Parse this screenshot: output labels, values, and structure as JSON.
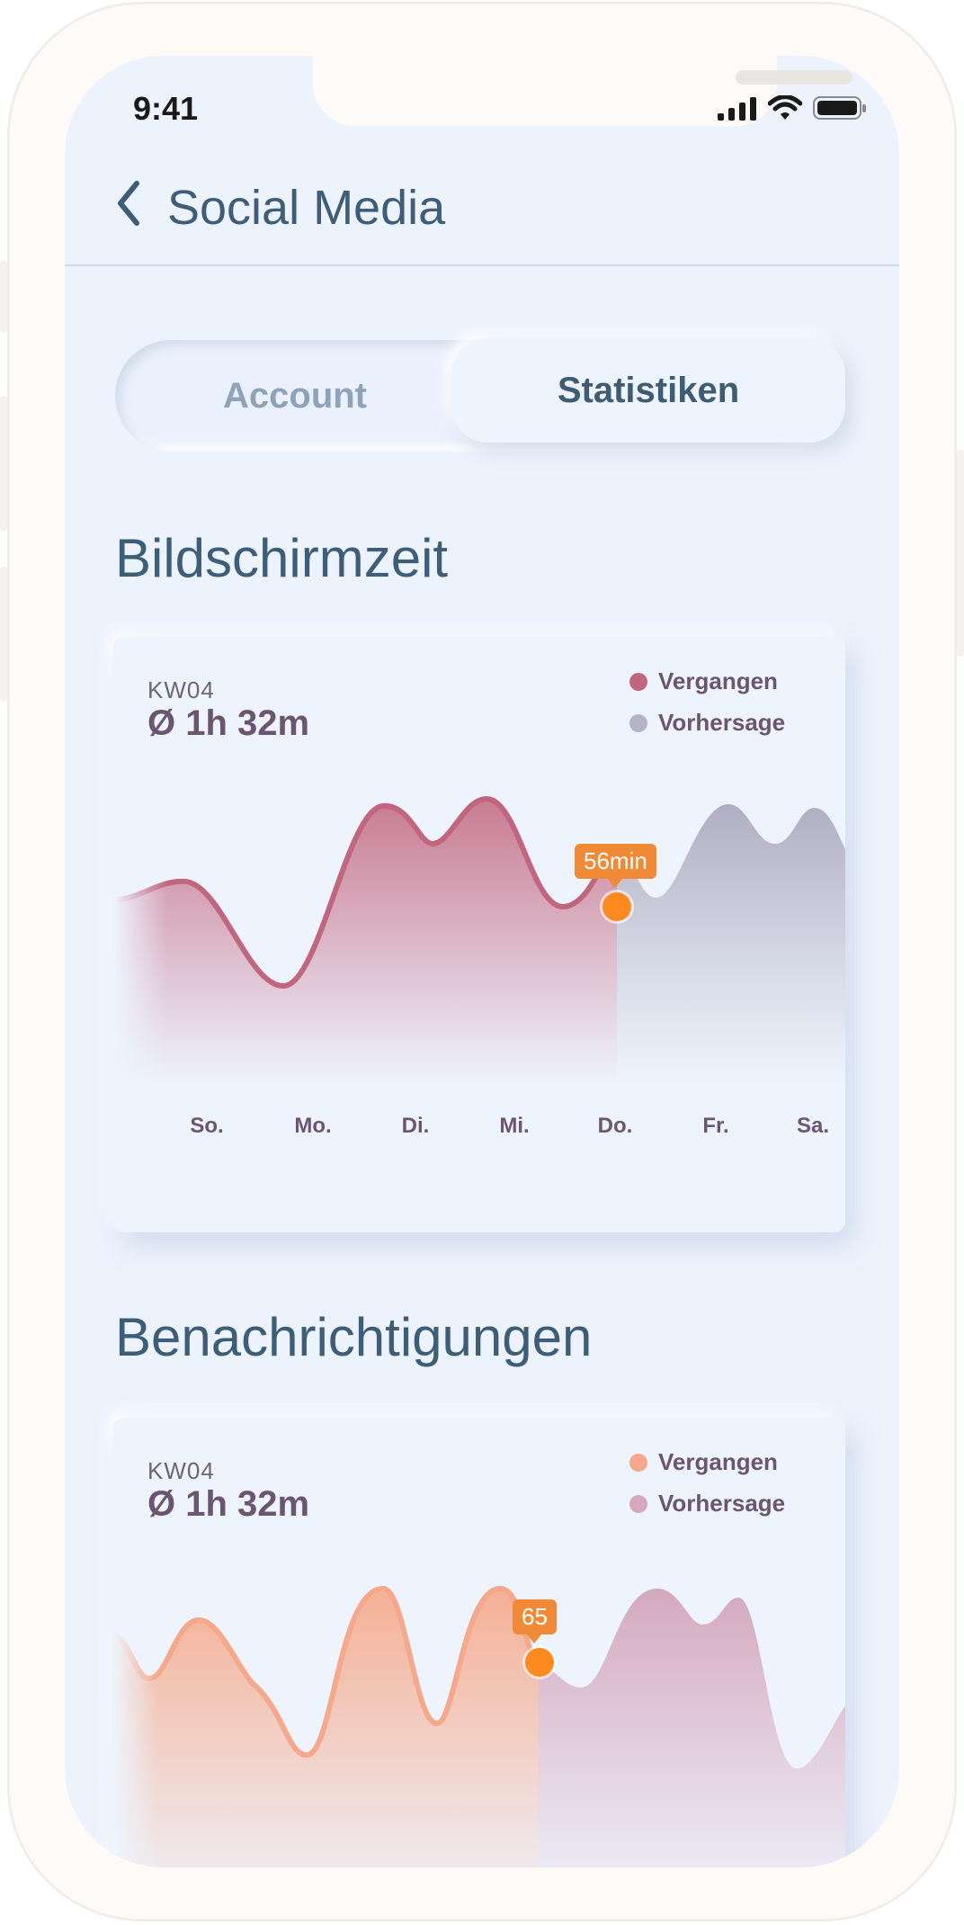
{
  "status_bar": {
    "time": "9:41"
  },
  "nav": {
    "title": "Social Media"
  },
  "tabs": {
    "left": "Account",
    "right": "Statistiken",
    "selected": "Statistiken"
  },
  "colors": {
    "past_screen": "#c2667f",
    "forecast_screen": "#b6b3c6",
    "past_notif": "#f5a98a",
    "forecast_notif": "#d8a9bd",
    "marker": "#ff8a1f"
  },
  "screen_time": {
    "section_title": "Bildschirmzeit",
    "week": "KW04",
    "average": "Ø 1h 32m",
    "legend_past": "Vergangen",
    "legend_forecast": "Vorhersage",
    "tooltip": "56min"
  },
  "notifications": {
    "section_title": "Benachrichtigungen",
    "week": "KW04",
    "average": "Ø 1h 32m",
    "legend_past": "Vergangen",
    "legend_forecast": "Vorhersage",
    "tooltip": "65"
  },
  "chart_data": [
    {
      "type": "area",
      "categories": [
        "So.",
        "Mo.",
        "Di.",
        "Mi.",
        "Do.",
        "Fr.",
        "Sa."
      ],
      "series": [
        {
          "name": "Vergangen",
          "values": [
            60,
            20,
            80,
            85,
            56
          ]
        },
        {
          "name": "Vorhersage",
          "values": [
            56,
            45,
            85,
            80
          ]
        }
      ],
      "annotations": [
        "56min"
      ]
    },
    {
      "type": "area",
      "series": [
        {
          "name": "Vergangen",
          "values": [
            55,
            75,
            45,
            30,
            90,
            35,
            95,
            65
          ]
        },
        {
          "name": "Vorhersage",
          "values": [
            65,
            55,
            95,
            80,
            90,
            20
          ]
        }
      ],
      "annotations": [
        "65"
      ]
    }
  ]
}
